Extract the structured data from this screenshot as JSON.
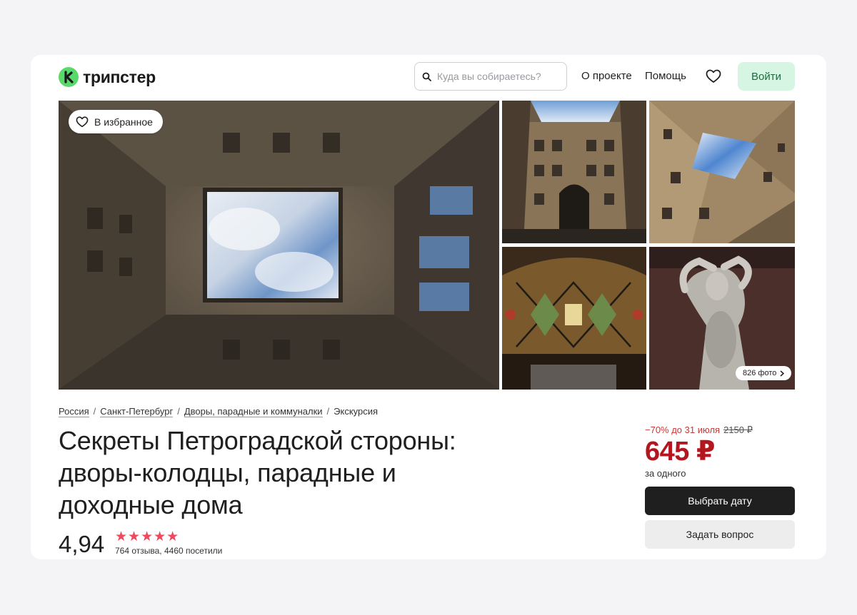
{
  "header": {
    "logo_text": "трипстер",
    "search_placeholder": "Куда вы собираетесь?",
    "nav_about": "О проекте",
    "nav_help": "Помощь",
    "login_label": "Войти"
  },
  "gallery": {
    "favorite_label": "В избранное",
    "photo_count_label": "826 фото"
  },
  "breadcrumb": [
    "Россия",
    "Санкт-Петербург",
    "Дворы, парадные и коммуналки",
    "Экскурсия"
  ],
  "tour": {
    "title": "Секреты Петроградской стороны: дворы-колодцы, парадные и доходные дома",
    "rating": "4,94",
    "stars": "★★★★★",
    "reviews_text": "764 отзыва, 4460 посетили"
  },
  "price": {
    "discount_text": "−70% до 31 июля",
    "old_price": "2150 ₽",
    "current_price": "645 ₽",
    "per_text": "за одного",
    "choose_date_label": "Выбрать дату",
    "ask_label": "Задать вопрос"
  },
  "colors": {
    "brand_green": "#59d96b",
    "price_red": "#b3161f",
    "star_red": "#ec4a5d",
    "login_bg": "#d6f5e3"
  }
}
